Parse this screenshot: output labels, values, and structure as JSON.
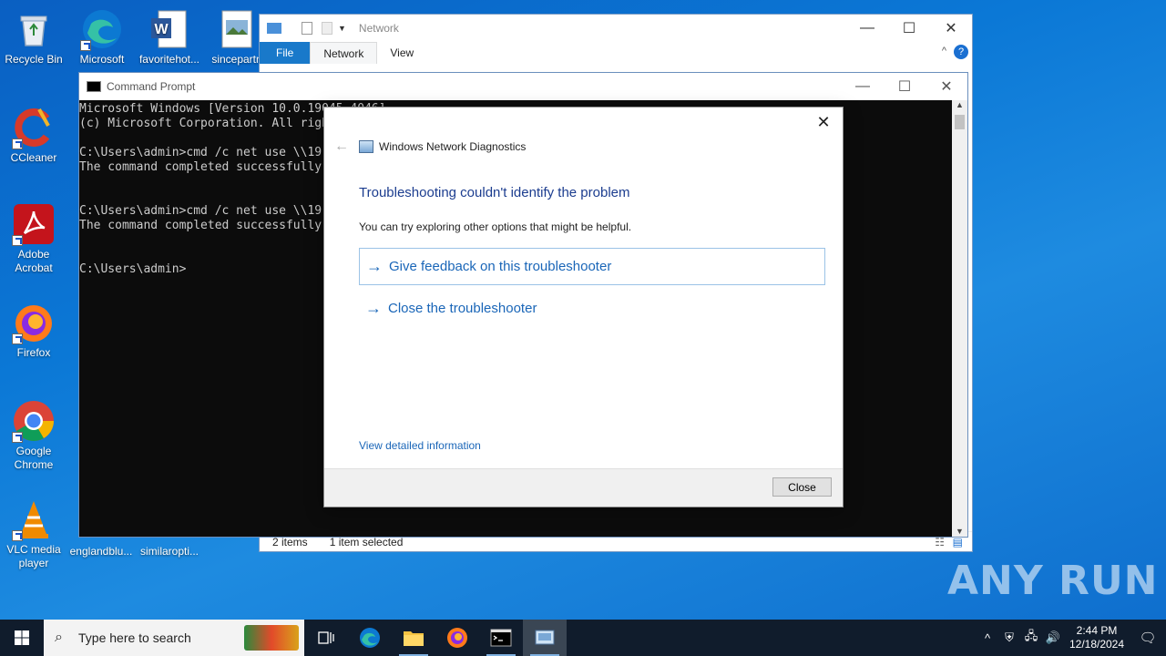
{
  "desktop": {
    "icons": [
      {
        "label": "Recycle Bin",
        "icon": "recycle-bin-icon"
      },
      {
        "label": "CCleaner",
        "icon": "ccleaner-icon"
      },
      {
        "label": "Adobe Acrobat",
        "icon": "acrobat-icon"
      },
      {
        "label": "Firefox",
        "icon": "firefox-icon"
      },
      {
        "label": "Google Chrome",
        "icon": "chrome-icon"
      },
      {
        "label": "VLC media player",
        "icon": "vlc-icon"
      },
      {
        "label": "Microsoft",
        "icon": "edge-icon"
      },
      {
        "label": "favoritehot...",
        "icon": "word-doc-icon"
      },
      {
        "label": "sincepartn",
        "icon": "image-file-icon"
      },
      {
        "label": "englandblu...",
        "icon": "file-icon"
      },
      {
        "label": "similaropti...",
        "icon": "file-icon"
      }
    ]
  },
  "explorer": {
    "title": "Network",
    "tabs": [
      "File",
      "Network",
      "View"
    ],
    "status_items": "2 items",
    "status_selected": "1 item selected"
  },
  "cmd": {
    "title": "Command Prompt",
    "lines": [
      "Microsoft Windows [Version 10.0.19045.4046]",
      "(c) Microsoft Corporation. All rights reserved.",
      "",
      "C:\\Users\\admin>cmd /c net use \\\\19",
      "The command completed successfully.",
      "",
      "",
      "C:\\Users\\admin>cmd /c net use \\\\19",
      "The command completed successfully.",
      "",
      "",
      "C:\\Users\\admin>"
    ]
  },
  "dialog": {
    "app_title": "Windows Network Diagnostics",
    "heading": "Troubleshooting couldn't identify the problem",
    "subtitle": "You can try exploring other options that might be helpful.",
    "option_feedback": "Give feedback on this troubleshooter",
    "option_close": "Close the troubleshooter",
    "detail_link": "View detailed information",
    "close_button": "Close"
  },
  "watermark": "ANY RUN",
  "taskbar": {
    "search_placeholder": "Type here to search",
    "time": "2:44 PM",
    "date": "12/18/2024"
  },
  "colors": {
    "link_blue": "#1a66b8",
    "heading_blue": "#1c3d8f",
    "taskbar_bg": "#101c2c"
  }
}
